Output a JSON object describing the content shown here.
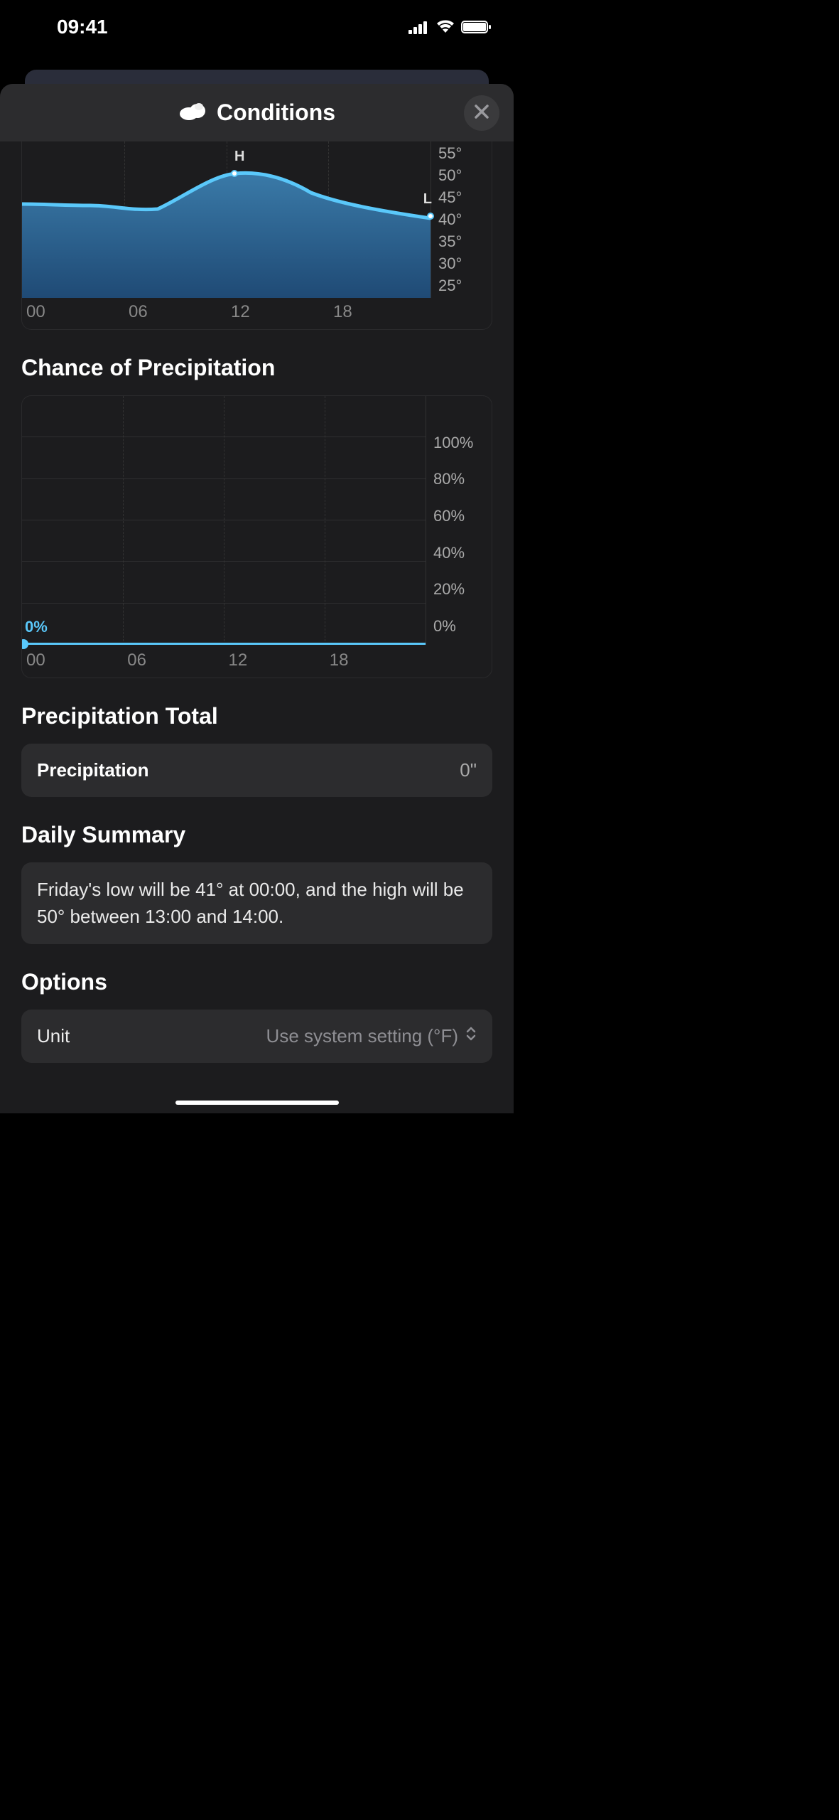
{
  "status": {
    "time": "09:41"
  },
  "modal": {
    "title": "Conditions"
  },
  "chart_data": [
    {
      "type": "area",
      "name": "temperature",
      "x": [
        0,
        2,
        4,
        6,
        8,
        10,
        12,
        14,
        16,
        18,
        20,
        22,
        24
      ],
      "values": [
        43,
        43,
        43,
        42,
        44,
        47,
        49,
        50,
        48,
        46,
        44,
        43,
        42
      ],
      "high": {
        "label": "H",
        "hour": 12,
        "value": 50
      },
      "low": {
        "label": "L",
        "hour": 24,
        "value": 42
      },
      "xticks": [
        "00",
        "06",
        "12",
        "18"
      ],
      "yticks": [
        "55°",
        "50°",
        "45°",
        "40°",
        "35°",
        "30°",
        "25°"
      ],
      "ylim": [
        25,
        55
      ],
      "xlabel": "",
      "ylabel": ""
    },
    {
      "type": "line",
      "name": "chance_of_precipitation",
      "title": "Chance of Precipitation",
      "x": [
        0,
        6,
        12,
        18,
        24
      ],
      "values": [
        0,
        0,
        0,
        0,
        0
      ],
      "current_label": "0%",
      "xticks": [
        "00",
        "06",
        "12",
        "18"
      ],
      "yticks": [
        "100%",
        "80%",
        "60%",
        "40%",
        "20%",
        "0%"
      ],
      "ylim": [
        0,
        100
      ],
      "xlabel": "",
      "ylabel": ""
    }
  ],
  "sections": {
    "precipitation_title": "Chance of Precipitation",
    "precip_total_title": "Precipitation Total",
    "precip_total_label": "Precipitation",
    "precip_total_value": "0\"",
    "daily_summary_title": "Daily Summary",
    "daily_summary_text": "Friday's low will be 41° at 00:00, and the high will be 50° between 13:00 and 14:00.",
    "options_title": "Options",
    "unit_label": "Unit",
    "unit_value": "Use system setting (°F)"
  }
}
